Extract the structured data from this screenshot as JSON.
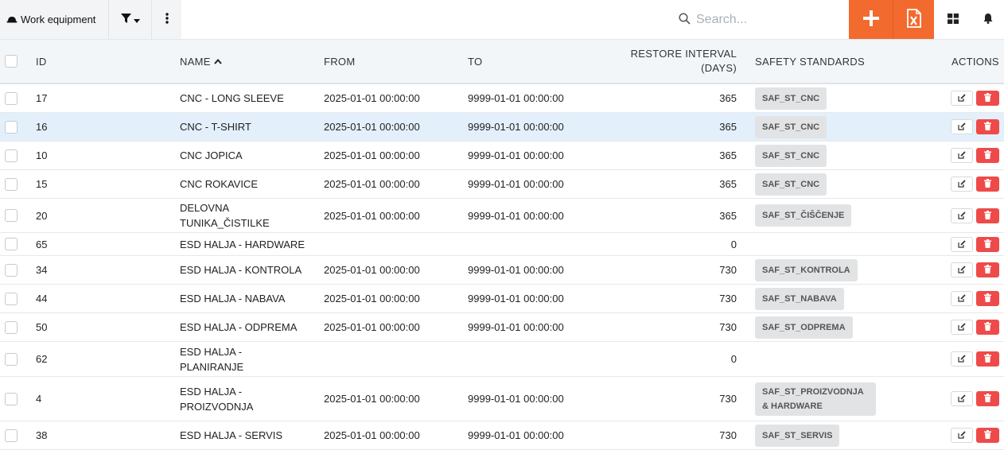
{
  "header": {
    "title": "Work equipment",
    "search_placeholder": "Search..."
  },
  "colors": {
    "accent": "#f26a2e",
    "danger": "#ef4a4a",
    "row_highlight": "#e3f0fb"
  },
  "icons": {
    "title": "cap-icon",
    "filter": "filter-icon",
    "more": "more-vertical-icon",
    "search": "search-icon",
    "add": "plus-icon",
    "excel": "excel-icon",
    "grid": "grid-icon",
    "bell": "bell-icon",
    "edit": "edit-icon",
    "delete": "trash-icon"
  },
  "table": {
    "columns": {
      "id": "ID",
      "name": "NAME",
      "from": "FROM",
      "to": "TO",
      "interval_line1": "RESTORE INTERVAL",
      "interval_line2": "(DAYS)",
      "safety": "SAFETY STANDARDS",
      "actions": "ACTIONS"
    },
    "sort": {
      "column": "name",
      "direction": "ascending"
    },
    "rows": [
      {
        "id": "17",
        "name": "CNC - LONG SLEEVE",
        "from": "2025-01-01 00:00:00",
        "to": "9999-01-01 00:00:00",
        "interval": "365",
        "safety": "SAF_ST_CNC"
      },
      {
        "id": "16",
        "name": "CNC - T-SHIRT",
        "from": "2025-01-01 00:00:00",
        "to": "9999-01-01 00:00:00",
        "interval": "365",
        "safety": "SAF_ST_CNC"
      },
      {
        "id": "10",
        "name": "CNC JOPICA",
        "from": "2025-01-01 00:00:00",
        "to": "9999-01-01 00:00:00",
        "interval": "365",
        "safety": "SAF_ST_CNC"
      },
      {
        "id": "15",
        "name": "CNC ROKAVICE",
        "from": "2025-01-01 00:00:00",
        "to": "9999-01-01 00:00:00",
        "interval": "365",
        "safety": "SAF_ST_CNC"
      },
      {
        "id": "20",
        "name": "DELOVNA TUNIKA_ČISTILKE",
        "from": "2025-01-01 00:00:00",
        "to": "9999-01-01 00:00:00",
        "interval": "365",
        "safety": "SAF_ST_ČIŠČENJE"
      },
      {
        "id": "65",
        "name": "ESD HALJA - HARDWARE",
        "from": "",
        "to": "",
        "interval": "0",
        "safety": ""
      },
      {
        "id": "34",
        "name": "ESD HALJA - KONTROLA",
        "from": "2025-01-01 00:00:00",
        "to": "9999-01-01 00:00:00",
        "interval": "730",
        "safety": "SAF_ST_KONTROLA"
      },
      {
        "id": "44",
        "name": "ESD HALJA - NABAVA",
        "from": "2025-01-01 00:00:00",
        "to": "9999-01-01 00:00:00",
        "interval": "730",
        "safety": "SAF_ST_NABAVA"
      },
      {
        "id": "50",
        "name": "ESD HALJA - ODPREMA",
        "from": "2025-01-01 00:00:00",
        "to": "9999-01-01 00:00:00",
        "interval": "730",
        "safety": "SAF_ST_ODPREMA"
      },
      {
        "id": "62",
        "name": "ESD HALJA - PLANIRANJE",
        "from": "",
        "to": "",
        "interval": "0",
        "safety": ""
      },
      {
        "id": "4",
        "name": "ESD HALJA - PROIZVODNJA",
        "from": "2025-01-01 00:00:00",
        "to": "9999-01-01 00:00:00",
        "interval": "730",
        "safety": "SAF_ST_PROIZVODNJA & HARDWARE"
      },
      {
        "id": "38",
        "name": "ESD HALJA - SERVIS",
        "from": "2025-01-01 00:00:00",
        "to": "9999-01-01 00:00:00",
        "interval": "730",
        "safety": "SAF_ST_SERVIS"
      }
    ]
  }
}
